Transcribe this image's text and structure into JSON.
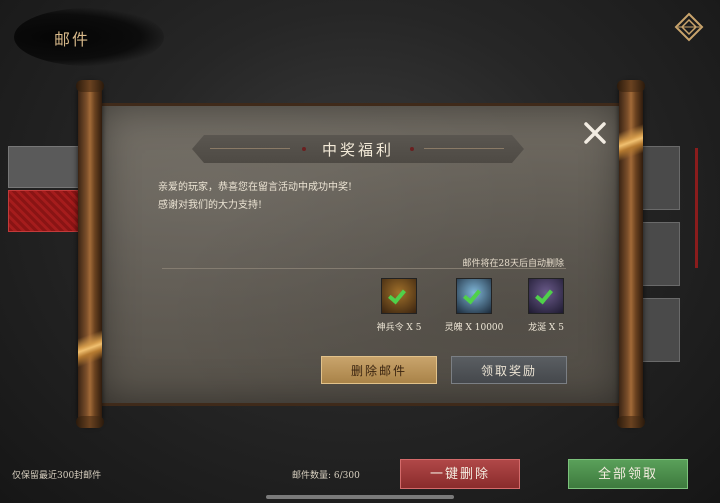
{
  "header": {
    "title": "邮件",
    "back_icon": "diamond-back-icon"
  },
  "mail": {
    "title": "中奖福利",
    "body_lines": [
      "亲爱的玩家，恭喜您在留言活动中成功中奖!",
      "感谢对我们的大力支持!"
    ],
    "auto_delete_notice": "邮件将在28天后自动删除",
    "rewards": [
      {
        "label": "神兵令 X 5",
        "icon": "weapon-token-icon",
        "claimed": true,
        "bg": "#5a3a14"
      },
      {
        "label": "灵魄 X 10000",
        "icon": "spirit-soul-icon",
        "claimed": true,
        "bg": "#2a3a4e"
      },
      {
        "label": "龙涎 X 5",
        "icon": "dragon-saliva-icon",
        "claimed": true,
        "bg": "#2e2a44"
      }
    ],
    "delete_button": "删除邮件",
    "claim_button": "领取奖励",
    "close_icon": "close-icon"
  },
  "footer": {
    "note": "仅保留最近300封邮件",
    "count_label": "邮件数量: 6/300",
    "delete_all_button": "一键删除",
    "claim_all_button": "全部领取"
  },
  "colors": {
    "accent_gold": "#d8b98a",
    "delete_red": "#b04848",
    "claim_green": "#5aa05a",
    "check_green": "#4fd14a"
  }
}
